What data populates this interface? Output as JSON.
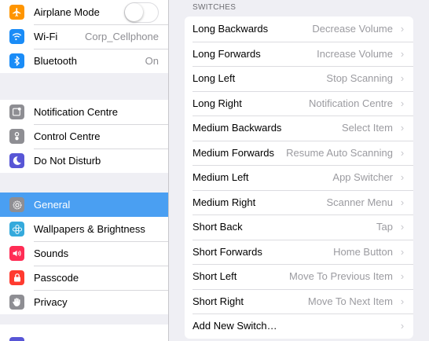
{
  "sidebar": {
    "group1": [
      {
        "label": "Airplane Mode",
        "icon": "airplane-icon",
        "color": "#ff9500",
        "type": "toggle",
        "toggle_on": false
      },
      {
        "label": "Wi-Fi",
        "icon": "wifi-icon",
        "color": "#1a8cf7",
        "value": "Corp_Cellphone"
      },
      {
        "label": "Bluetooth",
        "icon": "bluetooth-icon",
        "color": "#1a8cf7",
        "value": "On"
      }
    ],
    "group2": [
      {
        "label": "Notification Centre",
        "icon": "notification-centre-icon",
        "color": "#8e8e93"
      },
      {
        "label": "Control Centre",
        "icon": "control-centre-icon",
        "color": "#8e8e93"
      },
      {
        "label": "Do Not Disturb",
        "icon": "moon-icon",
        "color": "#5856d6"
      }
    ],
    "group3": [
      {
        "label": "General",
        "icon": "gear-icon",
        "color": "#8e8e93",
        "selected": true
      },
      {
        "label": "Wallpapers & Brightness",
        "icon": "wallpaper-icon",
        "color": "#35aadc"
      },
      {
        "label": "Sounds",
        "icon": "speaker-icon",
        "color": "#ff2d55"
      },
      {
        "label": "Passcode",
        "icon": "lock-icon",
        "color": "#ff3b30"
      },
      {
        "label": "Privacy",
        "icon": "hand-icon",
        "color": "#8e8e93"
      }
    ],
    "selected_color": "#4a9ff2"
  },
  "main": {
    "section_header": "SWITCHES",
    "switches": [
      {
        "label": "Long Backwards",
        "value": "Decrease Volume"
      },
      {
        "label": "Long Forwards",
        "value": "Increase Volume"
      },
      {
        "label": "Long Left",
        "value": "Stop Scanning"
      },
      {
        "label": "Long Right",
        "value": "Notification Centre"
      },
      {
        "label": "Medium Backwards",
        "value": "Select Item"
      },
      {
        "label": "Medium Forwards",
        "value": "Resume Auto Scanning"
      },
      {
        "label": "Medium Left",
        "value": "App Switcher"
      },
      {
        "label": "Medium Right",
        "value": "Scanner Menu"
      },
      {
        "label": "Short Back",
        "value": "Tap"
      },
      {
        "label": "Short Forwards",
        "value": "Home Button"
      },
      {
        "label": "Short Left",
        "value": "Move To Previous Item"
      },
      {
        "label": "Short Right",
        "value": "Move To Next Item"
      },
      {
        "label": "Add New Switch…",
        "value": ""
      }
    ],
    "chevron": "›"
  }
}
